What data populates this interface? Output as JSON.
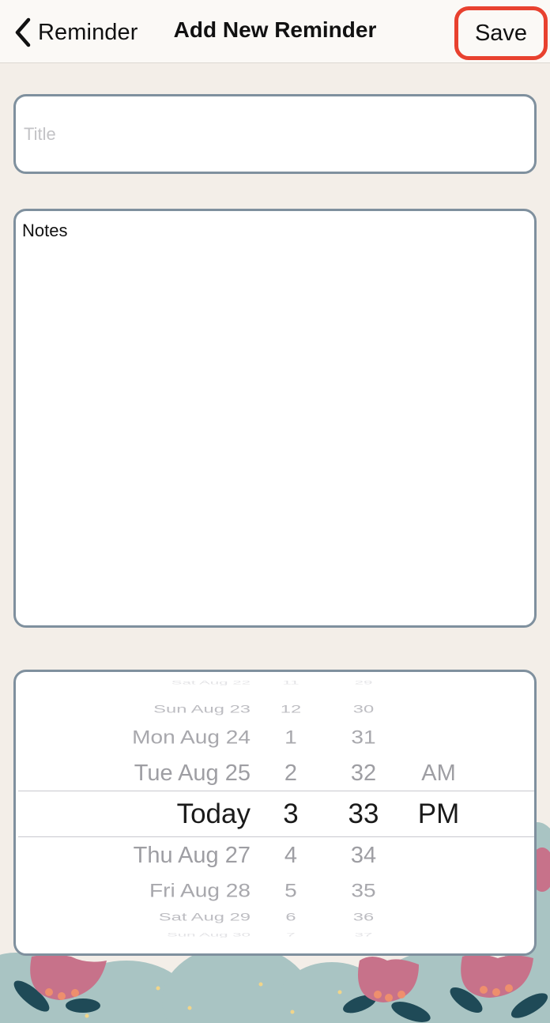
{
  "nav": {
    "back_label": "Reminder",
    "title": "Add New Reminder",
    "save_label": "Save"
  },
  "title_field": {
    "placeholder": "Title",
    "value": ""
  },
  "notes_field": {
    "value": "Notes"
  },
  "picker": {
    "rows": [
      {
        "date": "Sat Aug 22",
        "hour": "11",
        "minute": "29",
        "ampm": ""
      },
      {
        "date": "Sun Aug 23",
        "hour": "12",
        "minute": "30",
        "ampm": ""
      },
      {
        "date": "Mon Aug 24",
        "hour": "1",
        "minute": "31",
        "ampm": ""
      },
      {
        "date": "Tue Aug 25",
        "hour": "2",
        "minute": "32",
        "ampm": "AM"
      },
      {
        "date": "Today",
        "hour": "3",
        "minute": "33",
        "ampm": "PM"
      },
      {
        "date": "Thu Aug 27",
        "hour": "4",
        "minute": "34",
        "ampm": ""
      },
      {
        "date": "Fri Aug 28",
        "hour": "5",
        "minute": "35",
        "ampm": ""
      },
      {
        "date": "Sat Aug 29",
        "hour": "6",
        "minute": "36",
        "ampm": ""
      },
      {
        "date": "Sun Aug 30",
        "hour": "7",
        "minute": "37",
        "ampm": ""
      }
    ],
    "selected_index": 4
  },
  "colors": {
    "background": "#f3eee8",
    "field_border": "#7f909e",
    "highlight": "#e8412f",
    "flower": "#c7728a",
    "leaf": "#1f4a57",
    "bush": "#a9c4c3"
  }
}
